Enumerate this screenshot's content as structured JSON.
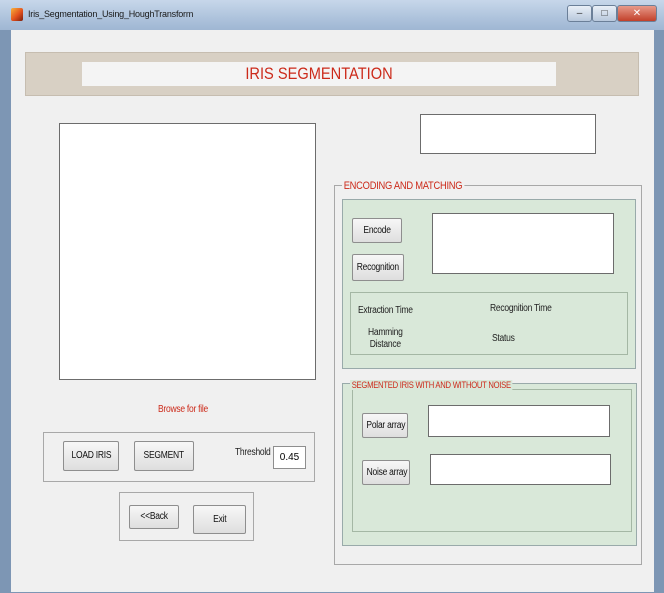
{
  "window": {
    "title": "Iris_Segmentation_Using_HoughTransform",
    "controls": {
      "minimize": "–",
      "maximize": "□",
      "close": "✕"
    }
  },
  "header": {
    "title": "IRIS SEGMENTATION"
  },
  "left": {
    "browse_label": "Browse for file",
    "load_iris_label": "LOAD IRIS",
    "segment_label": "SEGMENT",
    "threshold_label": "Threshold",
    "threshold_value": "0.45",
    "back_label": "<<Back",
    "exit_label": "Exit"
  },
  "encoding": {
    "title": "ENCODING AND MATCHING",
    "encode_label": "Encode",
    "recognition_label": "Recognition",
    "extraction_time_label": "Extraction Time",
    "recognition_time_label": "Recognition Time",
    "hamming_label_line1": "Hamming",
    "hamming_label_line2": "Distance",
    "status_label": "Status"
  },
  "segmented": {
    "title": "SEGMENTED IRIS WITH AND WITHOUT NOISE",
    "polar_array_label": "Polar array",
    "noise_array_label": "Noise array"
  },
  "colors": {
    "accent_red": "#cc2a1a",
    "panel_green": "#d9e8d9",
    "header_tan": "#d8d0c4",
    "window_bg": "#f0f0f0"
  }
}
